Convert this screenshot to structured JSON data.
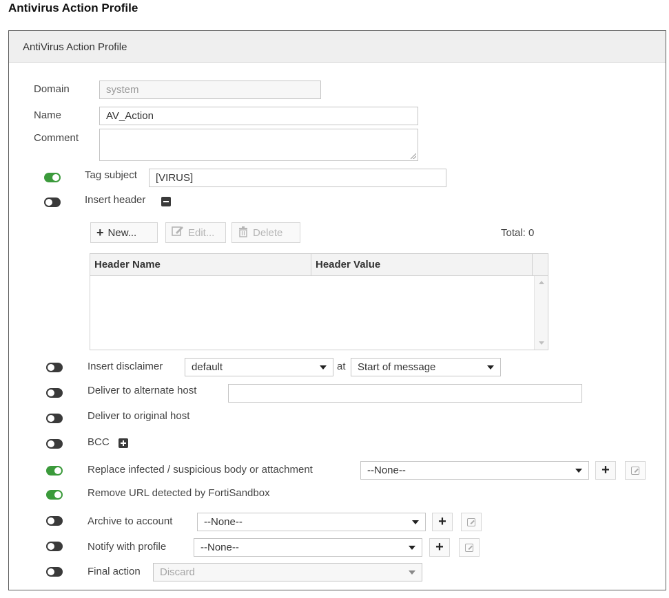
{
  "page_title": "Antivirus Action Profile",
  "panel": {
    "title": "AntiVirus Action Profile"
  },
  "fields": {
    "domain": {
      "label": "Domain",
      "value": "system"
    },
    "name": {
      "label": "Name",
      "value": "AV_Action"
    },
    "comment": {
      "label": "Comment",
      "value": ""
    }
  },
  "tag_subject": {
    "label": "Tag subject",
    "value": "[VIRUS]",
    "enabled": true
  },
  "insert_header": {
    "label": "Insert header",
    "enabled": false,
    "toolbar": {
      "new_label": "New...",
      "edit_label": "Edit...",
      "delete_label": "Delete",
      "total_label": "Total: 0"
    },
    "table": {
      "columns": [
        "Header Name",
        "Header Value"
      ],
      "rows": []
    }
  },
  "insert_disclaimer": {
    "label": "Insert disclaimer",
    "value": "default",
    "at_label": "at",
    "position_value": "Start of message",
    "enabled": false
  },
  "deliver_alternate_host": {
    "label": "Deliver to alternate host",
    "value": "",
    "enabled": false
  },
  "deliver_original_host": {
    "label": "Deliver to original host",
    "enabled": false
  },
  "bcc": {
    "label": "BCC",
    "enabled": false
  },
  "replace_infected": {
    "label": "Replace infected / suspicious body or attachment",
    "value": "--None--",
    "enabled": true
  },
  "remove_url": {
    "label": "Remove URL detected by FortiSandbox",
    "enabled": true
  },
  "archive_to_account": {
    "label": "Archive to account",
    "value": "--None--",
    "enabled": false
  },
  "notify_with_profile": {
    "label": "Notify with profile",
    "value": "--None--",
    "enabled": false
  },
  "final_action": {
    "label": "Final action",
    "value": "Discard",
    "enabled": false
  },
  "colors": {
    "toggle_on": "#3b9a3b",
    "toggle_off": "#3a3a3a",
    "header_bg": "#efefef",
    "border": "#5a5a5a"
  }
}
